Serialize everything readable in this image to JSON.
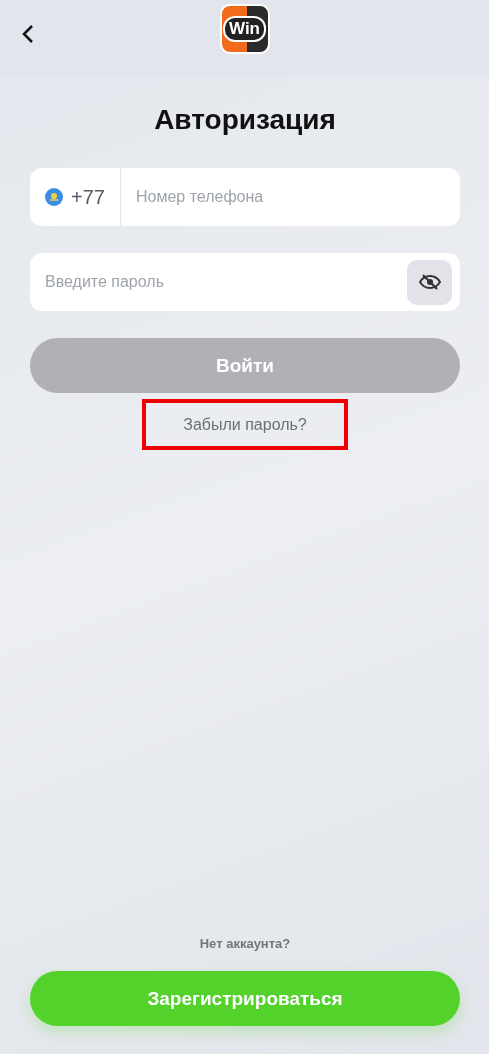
{
  "header": {
    "logo_text": "Win"
  },
  "title": "Авторизация",
  "phone_field": {
    "country_code": "+77",
    "placeholder": "Номер телефона"
  },
  "password_field": {
    "placeholder": "Введите пароль",
    "password_visible": false
  },
  "login_button": {
    "label": "Войти",
    "disabled": true
  },
  "forgot_link": {
    "label": "Забыли пароль?",
    "highlighted": true
  },
  "no_account_text": "Нет аккаунта?",
  "register_button": {
    "label": "Зарегистрироваться"
  }
}
